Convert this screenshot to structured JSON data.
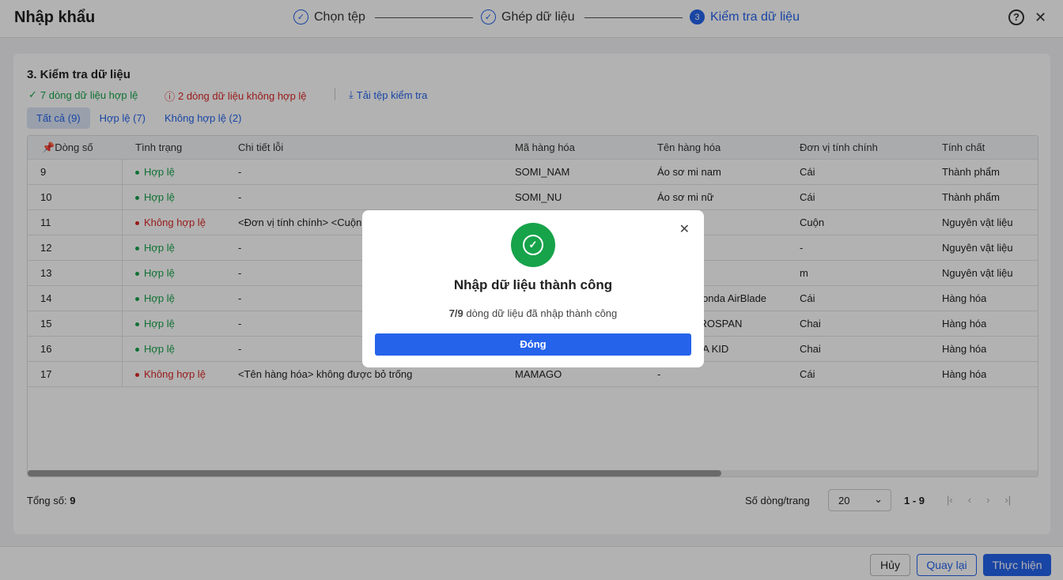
{
  "header": {
    "title": "Nhập khẩu",
    "steps": [
      {
        "num": "✓",
        "label": "Chọn tệp"
      },
      {
        "num": "✓",
        "label": "Ghép dữ liệu"
      },
      {
        "num": "3",
        "label": "Kiểm tra dữ liệu"
      }
    ],
    "help": "?",
    "close": "✕"
  },
  "section": {
    "title": "3. Kiểm tra dữ liệu",
    "valid": "7 dòng dữ liệu hợp lệ",
    "invalid": "2 dòng dữ liệu không hợp lệ",
    "download": "Tải tệp kiểm tra"
  },
  "tabs": [
    "Tất cả (9)",
    "Hợp lệ (7)",
    "Không hợp lệ (2)"
  ],
  "table": {
    "columns": [
      "Dòng số",
      "Tình trạng",
      "Chi tiết lỗi",
      "Mã hàng hóa",
      "Tên hàng hóa",
      "Đơn vị tính chính",
      "Tính chất"
    ],
    "rows": [
      [
        "9",
        "Hợp lệ",
        "-",
        "SOMI_NAM",
        "Áo sơ mi nam",
        "Cái",
        "Thành phẩm"
      ],
      [
        "10",
        "Hợp lệ",
        "-",
        "SOMI_NU",
        "Áo sơ mi nữ",
        "Cái",
        "Thành phẩm"
      ],
      [
        "11",
        "Không hợp lệ",
        "<Đơn vị tính chính> <Cuộn>",
        "",
        "",
        "Cuộn",
        "Nguyên vật liệu"
      ],
      [
        "12",
        "Hợp lệ",
        "-",
        "",
        "",
        "-",
        "Nguyên vật liệu"
      ],
      [
        "13",
        "Hợp lệ",
        "-",
        "",
        "",
        "m",
        "Nguyên vật liệu"
      ],
      [
        "14",
        "Hợp lệ",
        "-",
        "",
        "Xe máy Honda AirBlade",
        "Cái",
        "Hàng hóa"
      ],
      [
        "15",
        "Hợp lệ",
        "-",
        "",
        "Siro ho PROSPAN",
        "Chai",
        "Hàng hóa"
      ],
      [
        "16",
        "Hợp lệ",
        "-",
        "",
        "Siro PEDIA KID",
        "Chai",
        "Hàng hóa"
      ],
      [
        "17",
        "Không hợp lệ",
        "<Tên hàng hóa> không được bỏ trống",
        "MAMAGO",
        "-",
        "Cái",
        "Hàng hóa"
      ]
    ]
  },
  "footer": {
    "total_label": "Tổng số:",
    "total": "9",
    "per_page_label": "Số dòng/trang",
    "per_page": "20",
    "range": "1 - 9"
  },
  "buttons": {
    "cancel": "Hủy",
    "back": "Quay lại",
    "submit": "Thực hiện"
  },
  "modal": {
    "title": "Nhập dữ liệu thành công",
    "count": "7/9",
    "message": "dòng dữ liệu đã nhập thành công",
    "close_label": "Đóng"
  },
  "colors": {
    "primary": "#2563eb",
    "success": "#16a34a",
    "error": "#dc2626"
  }
}
